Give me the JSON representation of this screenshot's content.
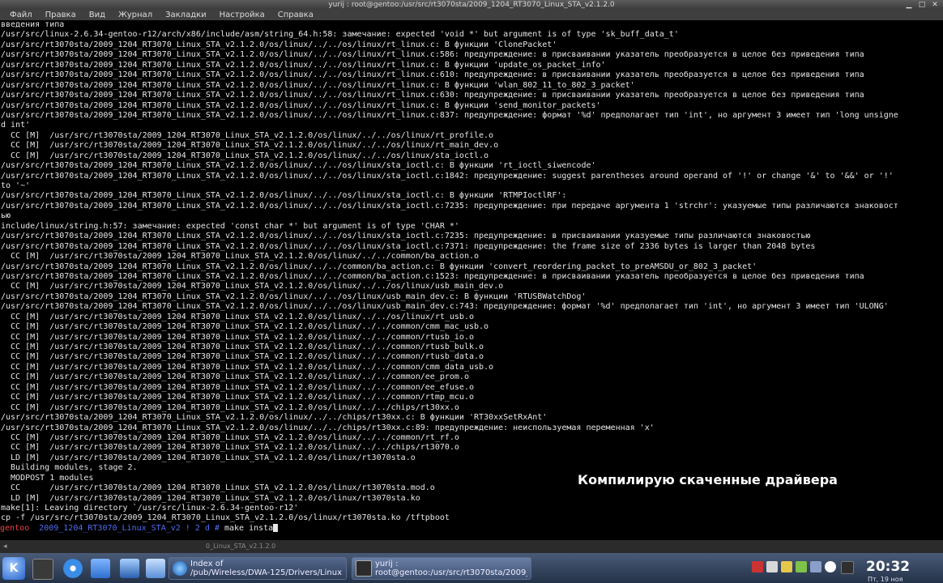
{
  "window": {
    "title": "yurij : root@gentoo:/usr/src/rt3070sta/2009_1204_RT3070_Linux_STA_v2.1.2.0"
  },
  "menu": [
    "Файл",
    "Правка",
    "Вид",
    "Журнал",
    "Закладки",
    "Настройка",
    "Справка"
  ],
  "terminal": {
    "lines": [
      "введения типа",
      "/usr/src/linux-2.6.34-gentoo-r12/arch/x86/include/asm/string_64.h:58: замечание: expected 'void *' but argument is of type 'sk_buff_data_t'",
      "/usr/src/rt3070sta/2009_1204_RT3070_Linux_STA_v2.1.2.0/os/linux/../../os/linux/rt_linux.c: В функции 'ClonePacket'",
      "/usr/src/rt3070sta/2009_1204_RT3070_Linux_STA_v2.1.2.0/os/linux/../../os/linux/rt_linux.c:586: предупреждение: в присваивании указатель преобразуется в целое без приведения типа",
      "/usr/src/rt3070sta/2009_1204_RT3070_Linux_STA_v2.1.2.0/os/linux/../../os/linux/rt_linux.c: В функции 'update_os_packet_info'",
      "/usr/src/rt3070sta/2009_1204_RT3070_Linux_STA_v2.1.2.0/os/linux/../../os/linux/rt_linux.c:610: предупреждение: в присваивании указатель преобразуется в целое без приведения типа",
      "/usr/src/rt3070sta/2009_1204_RT3070_Linux_STA_v2.1.2.0/os/linux/../../os/linux/rt_linux.c: В функции 'wlan_802_11_to_802_3_packet'",
      "/usr/src/rt3070sta/2009_1204_RT3070_Linux_STA_v2.1.2.0/os/linux/../../os/linux/rt_linux.c:630: предупреждение: в присваивании указатель преобразуется в целое без приведения типа",
      "/usr/src/rt3070sta/2009_1204_RT3070_Linux_STA_v2.1.2.0/os/linux/../../os/linux/rt_linux.c: В функции 'send_monitor_packets'",
      "/usr/src/rt3070sta/2009_1204_RT3070_Linux_STA_v2.1.2.0/os/linux/../../os/linux/rt_linux.c:837: предупреждение: формат '%d' предполагает тип 'int', но аргумент 3 имеет тип 'long unsigne",
      "d int'",
      "  CC [M]  /usr/src/rt3070sta/2009_1204_RT3070_Linux_STA_v2.1.2.0/os/linux/../../os/linux/rt_profile.o",
      "  CC [M]  /usr/src/rt3070sta/2009_1204_RT3070_Linux_STA_v2.1.2.0/os/linux/../../os/linux/rt_main_dev.o",
      "  CC [M]  /usr/src/rt3070sta/2009_1204_RT3070_Linux_STA_v2.1.2.0/os/linux/../../os/linux/sta_ioctl.o",
      "/usr/src/rt3070sta/2009_1204_RT3070_Linux_STA_v2.1.2.0/os/linux/../../os/linux/sta_ioctl.c: В функции 'rt_ioctl_siwencode'",
      "/usr/src/rt3070sta/2009_1204_RT3070_Linux_STA_v2.1.2.0/os/linux/../../os/linux/sta_ioctl.c:1842: предупреждение: suggest parentheses around operand of '!' or change '&' to '&&' or '!'",
      "to '~'",
      "/usr/src/rt3070sta/2009_1204_RT3070_Linux_STA_v2.1.2.0/os/linux/../../os/linux/sta_ioctl.c: В функции 'RTMPIoctlRF':",
      "/usr/src/rt3070sta/2009_1204_RT3070_Linux_STA_v2.1.2.0/os/linux/../../os/linux/sta_ioctl.c:7235: предупреждение: при передаче аргумента 1 'strchr': указуемые типы различаются знаковост",
      "ью",
      "include/linux/string.h:57: замечание: expected 'const char *' but argument is of type 'CHAR *'",
      "/usr/src/rt3070sta/2009_1204_RT3070_Linux_STA_v2.1.2.0/os/linux/../../os/linux/sta_ioctl.c:7235: предупреждение: в присваивании указуемые типы различаются знаковостью",
      "/usr/src/rt3070sta/2009_1204_RT3070_Linux_STA_v2.1.2.0/os/linux/../../os/linux/sta_ioctl.c:7371: предупреждение: the frame size of 2336 bytes is larger than 2048 bytes",
      "  CC [M]  /usr/src/rt3070sta/2009_1204_RT3070_Linux_STA_v2.1.2.0/os/linux/../../common/ba_action.o",
      "/usr/src/rt3070sta/2009_1204_RT3070_Linux_STA_v2.1.2.0/os/linux/../../common/ba_action.c: В функции 'convert_reordering_packet_to_preAMSDU_or_802_3_packet'",
      "/usr/src/rt3070sta/2009_1204_RT3070_Linux_STA_v2.1.2.0/os/linux/../../common/ba_action.c:1523: предупреждение: в присваивании указатель преобразуется в целое без приведения типа",
      "  CC [M]  /usr/src/rt3070sta/2009_1204_RT3070_Linux_STA_v2.1.2.0/os/linux/../../os/linux/usb_main_dev.o",
      "/usr/src/rt3070sta/2009_1204_RT3070_Linux_STA_v2.1.2.0/os/linux/../../os/linux/usb_main_dev.c: В функции 'RTUSBWatchDog'",
      "/usr/src/rt3070sta/2009_1204_RT3070_Linux_STA_v2.1.2.0/os/linux/../../os/linux/usb_main_dev.c:743: предупреждение: формат '%d' предполагает тип 'int', но аргумент 3 имеет тип 'ULONG'",
      "  CC [M]  /usr/src/rt3070sta/2009_1204_RT3070_Linux_STA_v2.1.2.0/os/linux/../../os/linux/rt_usb.o",
      "  CC [M]  /usr/src/rt3070sta/2009_1204_RT3070_Linux_STA_v2.1.2.0/os/linux/../../common/cmm_mac_usb.o",
      "  CC [M]  /usr/src/rt3070sta/2009_1204_RT3070_Linux_STA_v2.1.2.0/os/linux/../../common/rtusb_io.o",
      "  CC [M]  /usr/src/rt3070sta/2009_1204_RT3070_Linux_STA_v2.1.2.0/os/linux/../../common/rtusb_bulk.o",
      "  CC [M]  /usr/src/rt3070sta/2009_1204_RT3070_Linux_STA_v2.1.2.0/os/linux/../../common/rtusb_data.o",
      "  CC [M]  /usr/src/rt3070sta/2009_1204_RT3070_Linux_STA_v2.1.2.0/os/linux/../../common/cmm_data_usb.o",
      "  CC [M]  /usr/src/rt3070sta/2009_1204_RT3070_Linux_STA_v2.1.2.0/os/linux/../../common/ee_prom.o",
      "  CC [M]  /usr/src/rt3070sta/2009_1204_RT3070_Linux_STA_v2.1.2.0/os/linux/../../common/ee_efuse.o",
      "  CC [M]  /usr/src/rt3070sta/2009_1204_RT3070_Linux_STA_v2.1.2.0/os/linux/../../common/rtmp_mcu.o",
      "  CC [M]  /usr/src/rt3070sta/2009_1204_RT3070_Linux_STA_v2.1.2.0/os/linux/../../chips/rt30xx.o",
      "/usr/src/rt3070sta/2009_1204_RT3070_Linux_STA_v2.1.2.0/os/linux/../../chips/rt30xx.c: В функции 'RT30xxSetRxAnt'",
      "/usr/src/rt3070sta/2009_1204_RT3070_Linux_STA_v2.1.2.0/os/linux/../../chips/rt30xx.c:89: предупреждение: неиспользуемая переменная 'x'",
      "  CC [M]  /usr/src/rt3070sta/2009_1204_RT3070_Linux_STA_v2.1.2.0/os/linux/../../common/rt_rf.o",
      "  CC [M]  /usr/src/rt3070sta/2009_1204_RT3070_Linux_STA_v2.1.2.0/os/linux/../../chips/rt3070.o",
      "  LD [M]  /usr/src/rt3070sta/2009_1204_RT3070_Linux_STA_v2.1.2.0/os/linux/rt3070sta.o",
      "  Building modules, stage 2.",
      "  MODPOST 1 modules",
      "  CC      /usr/src/rt3070sta/2009_1204_RT3070_Linux_STA_v2.1.2.0/os/linux/rt3070sta.mod.o",
      "  LD [M]  /usr/src/rt3070sta/2009_1204_RT3070_Linux_STA_v2.1.2.0/os/linux/rt3070sta.ko",
      "make[1]: Leaving directory `/usr/src/linux-2.6.34-gentoo-r12'",
      "cp -f /usr/src/rt3070sta/2009_1204_RT3070_Linux_STA_v2.1.2.0/os/linux/rt3070sta.ko /tftpboot"
    ],
    "prompt": {
      "host": "gentoo",
      "path": " 2009_1204_RT3070_Linux_STA_v2 ",
      "sep": "! 2 d # ",
      "command": "make insta"
    }
  },
  "caption": "Компилирую скаченные драйвера",
  "scroll_tab": "0_Linux_STA_v2.1.2.0",
  "taskbar": {
    "start_label": "K",
    "tasks": [
      {
        "line1": "Index of",
        "line2": "/pub/Wireless/DWA-125/Drivers/Linux -"
      },
      {
        "line1": "yurij :",
        "line2": "root@gentoo:/usr/src/rt3070sta/2009_"
      }
    ],
    "clock_time": "20:32",
    "clock_date": "Пт, 19 ноя"
  },
  "colors": {
    "prompt_host": "#e84343",
    "prompt_path": "#4f6df0",
    "terminal_text": "#e6e6e6"
  }
}
